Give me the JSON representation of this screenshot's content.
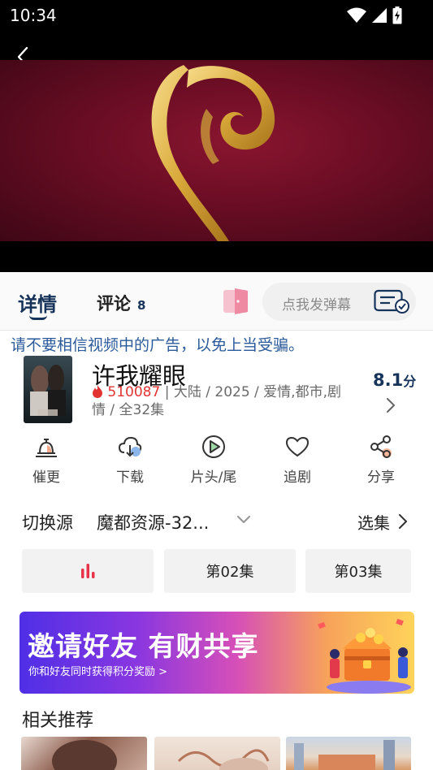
{
  "status_bar": {
    "time": "10:34",
    "icons": [
      "wifi-icon",
      "cellular-signal-icon",
      "battery-charging-icon"
    ]
  },
  "player": {
    "back_icon": "chevron-left-icon"
  },
  "tabs": {
    "detail_label": "详情",
    "comment_label": "评论",
    "comment_count": "8",
    "danmaku_placeholder": "点我发弹幕"
  },
  "warning_text": "请不要相信视频中的广告，以免上当受骗。",
  "show": {
    "title": "许我耀眼",
    "heat": "510087",
    "meta_rest": " | 大陆 / 2025 / 爱情,都市,剧情 / 全32集",
    "rating": "8.1",
    "rating_unit": "分"
  },
  "actions": [
    {
      "label": "催更",
      "icon": "bell-icon"
    },
    {
      "label": "下载",
      "icon": "cloud-download-icon"
    },
    {
      "label": "片头/尾",
      "icon": "play-circle-icon"
    },
    {
      "label": "追剧",
      "icon": "heart-icon"
    },
    {
      "label": "分享",
      "icon": "share-icon"
    }
  ],
  "source": {
    "label": "切换源",
    "value": "魔都资源-32...",
    "episodes_label": "选集"
  },
  "episodes": [
    "",
    "第02集",
    "第03集"
  ],
  "banner": {
    "title": "邀请好友 有财共享",
    "subtitle": "你和好友同时获得积分奖励 >"
  },
  "related": {
    "title": "相关推荐"
  },
  "colors": {
    "accent": "#16335a",
    "heat": "#e23333",
    "warning": "#2a5a9a",
    "playing": "#e8344a"
  }
}
